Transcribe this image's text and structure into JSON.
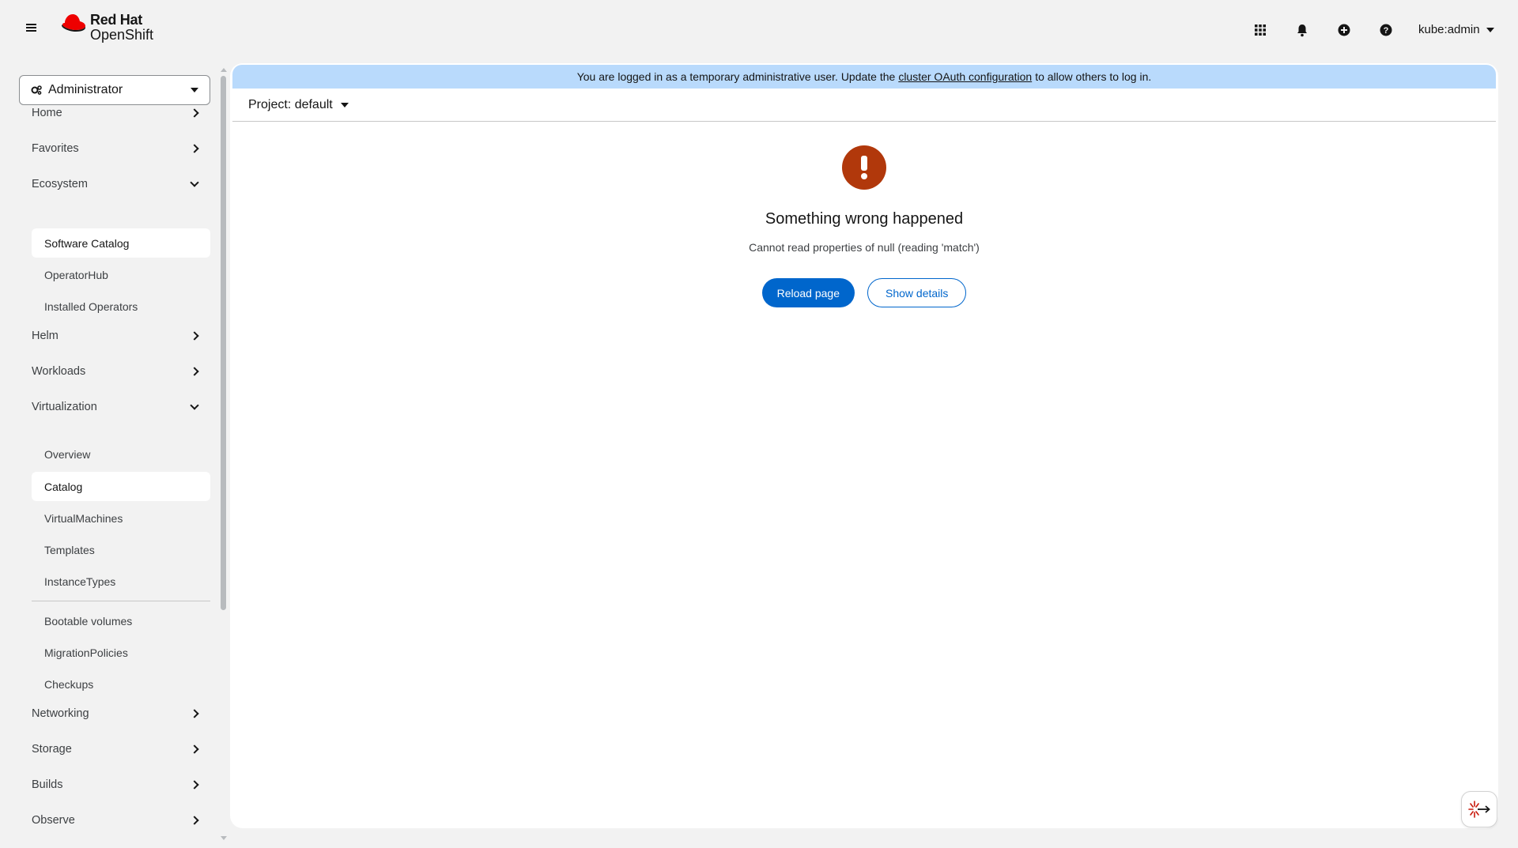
{
  "masthead": {
    "brand_line1": "Red Hat",
    "brand_line2": "OpenShift",
    "user": "kube:admin",
    "icons": [
      "menu-icon",
      "app-launcher-icon",
      "bell-icon",
      "plus-circle-icon",
      "question-circle-icon"
    ]
  },
  "sidebar": {
    "perspective": "Administrator",
    "items": {
      "home": "Home",
      "favorites": "Favorites",
      "ecosystem": "Ecosystem",
      "software_catalog": "Software Catalog",
      "operatorhub": "OperatorHub",
      "installed_operators": "Installed Operators",
      "helm": "Helm",
      "workloads": "Workloads",
      "virtualization": "Virtualization",
      "overview": "Overview",
      "catalog": "Catalog",
      "virtualmachines": "VirtualMachines",
      "templates": "Templates",
      "instancetypes": "InstanceTypes",
      "bootable_volumes": "Bootable volumes",
      "migrationpolicies": "MigrationPolicies",
      "checkups": "Checkups",
      "networking": "Networking",
      "storage": "Storage",
      "builds": "Builds",
      "observe": "Observe"
    }
  },
  "banner": {
    "text_before": "You are logged in as a temporary administrative user. Update the",
    "link": "cluster OAuth configuration",
    "text_after": "to allow others to log in."
  },
  "project": {
    "label": "Project: default"
  },
  "error": {
    "title": "Something wrong happened",
    "message": "Cannot read properties of null (reading 'match')",
    "reload_label": "Reload page",
    "details_label": "Show details"
  },
  "colors": {
    "accent": "#0066cc",
    "banner_bg": "#b9dafc",
    "error_icon": "#b1380b",
    "brand_red": "#ee0000"
  }
}
